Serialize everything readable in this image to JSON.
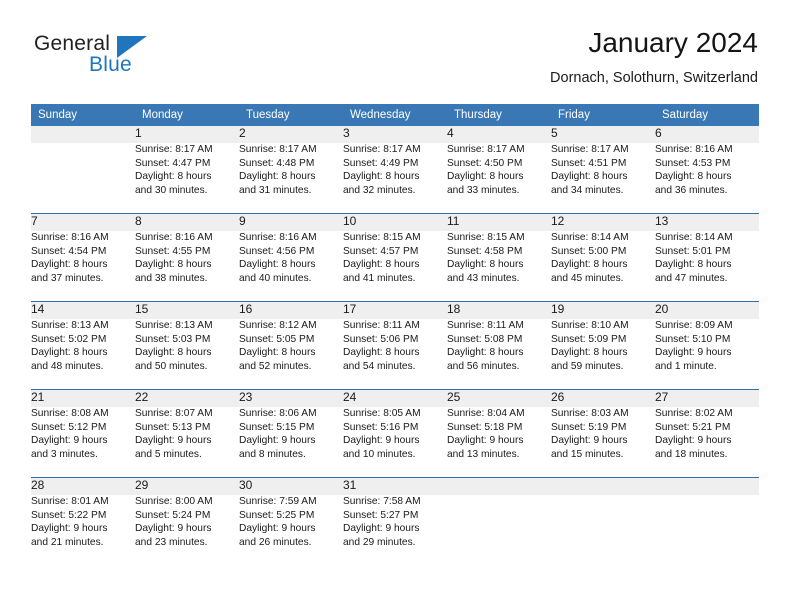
{
  "brand": {
    "line1": "General",
    "line2": "Blue",
    "triangle_icon": "triangle-icon",
    "colors": {
      "dark": "#231f20",
      "blue": "#1f76bd"
    }
  },
  "header": {
    "title": "January 2024",
    "subtitle": "Dornach, Solothurn, Switzerland"
  },
  "calendar": {
    "accent_color": "#3a77b5",
    "daynum_band_color": "#efefef",
    "weekday_headers": [
      "Sunday",
      "Monday",
      "Tuesday",
      "Wednesday",
      "Thursday",
      "Friday",
      "Saturday"
    ],
    "weeks": [
      {
        "days": [
          {
            "num": "",
            "sunrise": "",
            "sunset": "",
            "daylight_l1": "",
            "daylight_l2": ""
          },
          {
            "num": "1",
            "sunrise": "Sunrise: 8:17 AM",
            "sunset": "Sunset: 4:47 PM",
            "daylight_l1": "Daylight: 8 hours",
            "daylight_l2": "and 30 minutes."
          },
          {
            "num": "2",
            "sunrise": "Sunrise: 8:17 AM",
            "sunset": "Sunset: 4:48 PM",
            "daylight_l1": "Daylight: 8 hours",
            "daylight_l2": "and 31 minutes."
          },
          {
            "num": "3",
            "sunrise": "Sunrise: 8:17 AM",
            "sunset": "Sunset: 4:49 PM",
            "daylight_l1": "Daylight: 8 hours",
            "daylight_l2": "and 32 minutes."
          },
          {
            "num": "4",
            "sunrise": "Sunrise: 8:17 AM",
            "sunset": "Sunset: 4:50 PM",
            "daylight_l1": "Daylight: 8 hours",
            "daylight_l2": "and 33 minutes."
          },
          {
            "num": "5",
            "sunrise": "Sunrise: 8:17 AM",
            "sunset": "Sunset: 4:51 PM",
            "daylight_l1": "Daylight: 8 hours",
            "daylight_l2": "and 34 minutes."
          },
          {
            "num": "6",
            "sunrise": "Sunrise: 8:16 AM",
            "sunset": "Sunset: 4:53 PM",
            "daylight_l1": "Daylight: 8 hours",
            "daylight_l2": "and 36 minutes."
          }
        ]
      },
      {
        "days": [
          {
            "num": "7",
            "sunrise": "Sunrise: 8:16 AM",
            "sunset": "Sunset: 4:54 PM",
            "daylight_l1": "Daylight: 8 hours",
            "daylight_l2": "and 37 minutes."
          },
          {
            "num": "8",
            "sunrise": "Sunrise: 8:16 AM",
            "sunset": "Sunset: 4:55 PM",
            "daylight_l1": "Daylight: 8 hours",
            "daylight_l2": "and 38 minutes."
          },
          {
            "num": "9",
            "sunrise": "Sunrise: 8:16 AM",
            "sunset": "Sunset: 4:56 PM",
            "daylight_l1": "Daylight: 8 hours",
            "daylight_l2": "and 40 minutes."
          },
          {
            "num": "10",
            "sunrise": "Sunrise: 8:15 AM",
            "sunset": "Sunset: 4:57 PM",
            "daylight_l1": "Daylight: 8 hours",
            "daylight_l2": "and 41 minutes."
          },
          {
            "num": "11",
            "sunrise": "Sunrise: 8:15 AM",
            "sunset": "Sunset: 4:58 PM",
            "daylight_l1": "Daylight: 8 hours",
            "daylight_l2": "and 43 minutes."
          },
          {
            "num": "12",
            "sunrise": "Sunrise: 8:14 AM",
            "sunset": "Sunset: 5:00 PM",
            "daylight_l1": "Daylight: 8 hours",
            "daylight_l2": "and 45 minutes."
          },
          {
            "num": "13",
            "sunrise": "Sunrise: 8:14 AM",
            "sunset": "Sunset: 5:01 PM",
            "daylight_l1": "Daylight: 8 hours",
            "daylight_l2": "and 47 minutes."
          }
        ]
      },
      {
        "days": [
          {
            "num": "14",
            "sunrise": "Sunrise: 8:13 AM",
            "sunset": "Sunset: 5:02 PM",
            "daylight_l1": "Daylight: 8 hours",
            "daylight_l2": "and 48 minutes."
          },
          {
            "num": "15",
            "sunrise": "Sunrise: 8:13 AM",
            "sunset": "Sunset: 5:03 PM",
            "daylight_l1": "Daylight: 8 hours",
            "daylight_l2": "and 50 minutes."
          },
          {
            "num": "16",
            "sunrise": "Sunrise: 8:12 AM",
            "sunset": "Sunset: 5:05 PM",
            "daylight_l1": "Daylight: 8 hours",
            "daylight_l2": "and 52 minutes."
          },
          {
            "num": "17",
            "sunrise": "Sunrise: 8:11 AM",
            "sunset": "Sunset: 5:06 PM",
            "daylight_l1": "Daylight: 8 hours",
            "daylight_l2": "and 54 minutes."
          },
          {
            "num": "18",
            "sunrise": "Sunrise: 8:11 AM",
            "sunset": "Sunset: 5:08 PM",
            "daylight_l1": "Daylight: 8 hours",
            "daylight_l2": "and 56 minutes."
          },
          {
            "num": "19",
            "sunrise": "Sunrise: 8:10 AM",
            "sunset": "Sunset: 5:09 PM",
            "daylight_l1": "Daylight: 8 hours",
            "daylight_l2": "and 59 minutes."
          },
          {
            "num": "20",
            "sunrise": "Sunrise: 8:09 AM",
            "sunset": "Sunset: 5:10 PM",
            "daylight_l1": "Daylight: 9 hours",
            "daylight_l2": "and 1 minute."
          }
        ]
      },
      {
        "days": [
          {
            "num": "21",
            "sunrise": "Sunrise: 8:08 AM",
            "sunset": "Sunset: 5:12 PM",
            "daylight_l1": "Daylight: 9 hours",
            "daylight_l2": "and 3 minutes."
          },
          {
            "num": "22",
            "sunrise": "Sunrise: 8:07 AM",
            "sunset": "Sunset: 5:13 PM",
            "daylight_l1": "Daylight: 9 hours",
            "daylight_l2": "and 5 minutes."
          },
          {
            "num": "23",
            "sunrise": "Sunrise: 8:06 AM",
            "sunset": "Sunset: 5:15 PM",
            "daylight_l1": "Daylight: 9 hours",
            "daylight_l2": "and 8 minutes."
          },
          {
            "num": "24",
            "sunrise": "Sunrise: 8:05 AM",
            "sunset": "Sunset: 5:16 PM",
            "daylight_l1": "Daylight: 9 hours",
            "daylight_l2": "and 10 minutes."
          },
          {
            "num": "25",
            "sunrise": "Sunrise: 8:04 AM",
            "sunset": "Sunset: 5:18 PM",
            "daylight_l1": "Daylight: 9 hours",
            "daylight_l2": "and 13 minutes."
          },
          {
            "num": "26",
            "sunrise": "Sunrise: 8:03 AM",
            "sunset": "Sunset: 5:19 PM",
            "daylight_l1": "Daylight: 9 hours",
            "daylight_l2": "and 15 minutes."
          },
          {
            "num": "27",
            "sunrise": "Sunrise: 8:02 AM",
            "sunset": "Sunset: 5:21 PM",
            "daylight_l1": "Daylight: 9 hours",
            "daylight_l2": "and 18 minutes."
          }
        ]
      },
      {
        "days": [
          {
            "num": "28",
            "sunrise": "Sunrise: 8:01 AM",
            "sunset": "Sunset: 5:22 PM",
            "daylight_l1": "Daylight: 9 hours",
            "daylight_l2": "and 21 minutes."
          },
          {
            "num": "29",
            "sunrise": "Sunrise: 8:00 AM",
            "sunset": "Sunset: 5:24 PM",
            "daylight_l1": "Daylight: 9 hours",
            "daylight_l2": "and 23 minutes."
          },
          {
            "num": "30",
            "sunrise": "Sunrise: 7:59 AM",
            "sunset": "Sunset: 5:25 PM",
            "daylight_l1": "Daylight: 9 hours",
            "daylight_l2": "and 26 minutes."
          },
          {
            "num": "31",
            "sunrise": "Sunrise: 7:58 AM",
            "sunset": "Sunset: 5:27 PM",
            "daylight_l1": "Daylight: 9 hours",
            "daylight_l2": "and 29 minutes."
          },
          {
            "num": "",
            "sunrise": "",
            "sunset": "",
            "daylight_l1": "",
            "daylight_l2": ""
          },
          {
            "num": "",
            "sunrise": "",
            "sunset": "",
            "daylight_l1": "",
            "daylight_l2": ""
          },
          {
            "num": "",
            "sunrise": "",
            "sunset": "",
            "daylight_l1": "",
            "daylight_l2": ""
          }
        ]
      }
    ]
  }
}
